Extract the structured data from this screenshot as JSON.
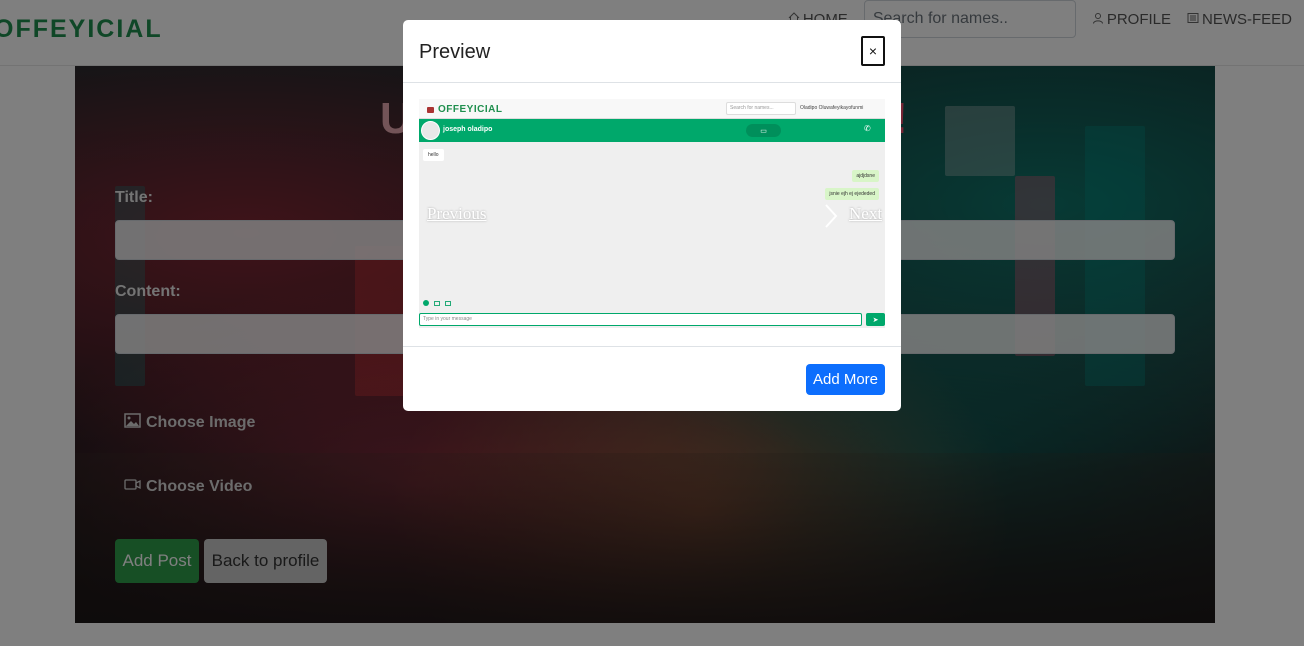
{
  "navbar": {
    "brand": "OFFEYICIAL",
    "home_label": "HOME",
    "search_placeholder": "Search for names..",
    "profile_label": "PROFILE",
    "newsfeed_label": "NEWS-FEED"
  },
  "form": {
    "heading_start": "U",
    "heading_end": "!",
    "title_label": "Title:",
    "content_label": "Content:",
    "choose_image_label": "Choose Image",
    "choose_video_label": "Choose Video",
    "add_post_label": "Add Post",
    "back_label": "Back to profile"
  },
  "modal": {
    "title": "Preview",
    "close_label": "×",
    "add_more_label": "Add More",
    "carousel": {
      "prev_label": "Previous",
      "next_label": "Next",
      "preview": {
        "brand": "OFFEYICIAL",
        "search_placeholder": "Search for names...",
        "user_name": "Oladipo Oluwafeyikayofunmi",
        "chat_name": "joseph oladipo",
        "msg_in": "hello",
        "msg_out_1": "ajdjdsne",
        "msg_out_2": "jsnie ejh ej ejededed",
        "input_placeholder": "Type in your message"
      }
    }
  },
  "colors": {
    "brand_green": "#1f8f4e",
    "primary_blue": "#0d6efd",
    "success_green": "#2e9e4a",
    "chat_green": "#00a86b"
  }
}
